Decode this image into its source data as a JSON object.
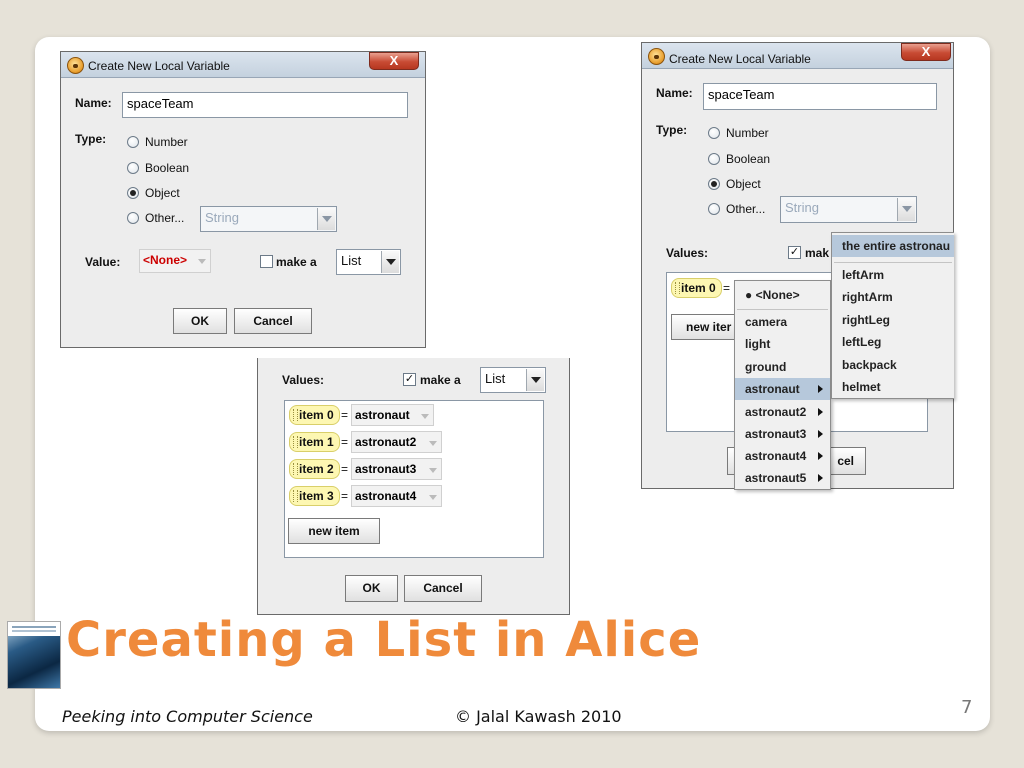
{
  "dialog_title": "Create New Local Variable",
  "close_label": "X",
  "labels": {
    "name": "Name:",
    "type": "Type:",
    "value": "Value:",
    "values": "Values:"
  },
  "name_value": "spaceTeam",
  "type_options": [
    "Number",
    "Boolean",
    "Object",
    "Other..."
  ],
  "selected_type": "Object",
  "other_type_value": "String",
  "value_choice": "<None>",
  "make_a_label": "make a",
  "make_a_cut_label": "mak",
  "make_a_type": "List",
  "ok_label": "OK",
  "cancel_label": "Cancel",
  "cancel_partial_label": "cel",
  "new_item_label": "new item",
  "new_item_partial_label": "new iter",
  "equals": "=",
  "list_items": [
    {
      "label": "item 0",
      "value": "astronaut"
    },
    {
      "label": "item 1",
      "value": "astronaut2"
    },
    {
      "label": "item 2",
      "value": "astronaut3"
    },
    {
      "label": "item 3",
      "value": "astronaut4"
    }
  ],
  "object_menu": {
    "none_option": "● <None>",
    "items": [
      "camera",
      "light",
      "ground",
      "astronaut",
      "astronaut2",
      "astronaut3",
      "astronaut4",
      "astronaut5"
    ],
    "highlighted": "astronaut"
  },
  "astronaut_submenu": {
    "header": "the entire astronau",
    "parts": [
      "leftArm",
      "rightArm",
      "rightLeg",
      "leftLeg",
      "backpack",
      "helmet"
    ]
  },
  "slide": {
    "title": "Creating a List in Alice",
    "footer_left": "Peeking into Computer Science",
    "footer_center": "© Jalal Kawash 2010",
    "page_number": "7"
  },
  "colors": {
    "title_orange": "#ef8a3b",
    "none_red": "#cc0000",
    "menu_highlight": "#b6c8db",
    "item_tag": "#fdf7b2"
  }
}
